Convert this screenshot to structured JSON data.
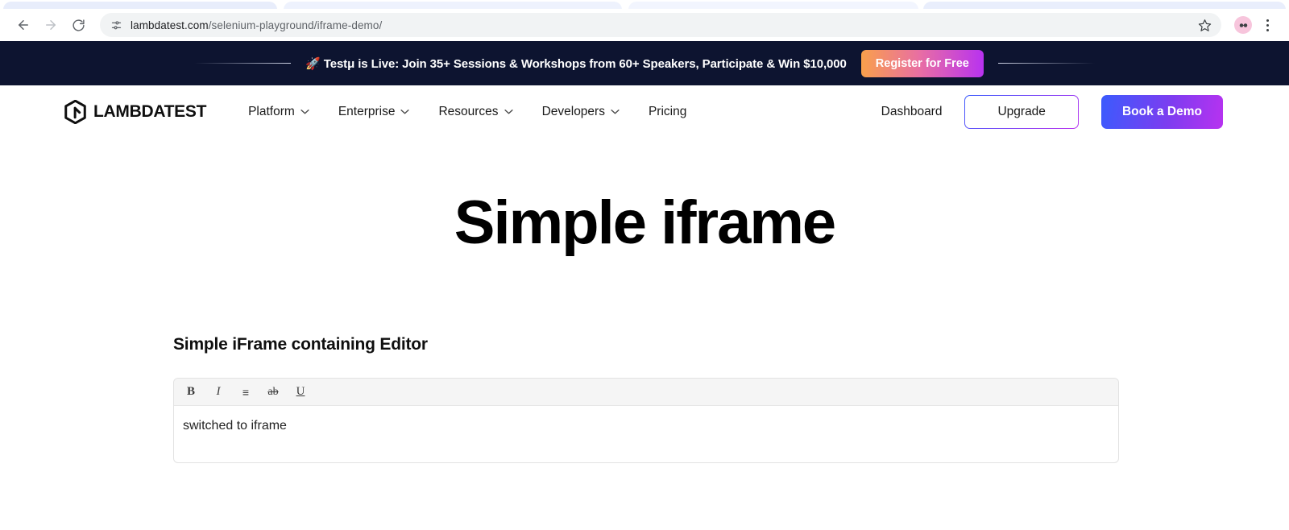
{
  "browser": {
    "back_label": "Back",
    "forward_label": "Forward",
    "reload_label": "Reload",
    "site_info_label": "Site information",
    "url_prefix": "lambdatest.com",
    "url_path": "/selenium-playground/iframe-demo/",
    "bookmark_label": "Bookmark this tab",
    "profile_label": "Profile",
    "menu_label": "Customize and control Chrome"
  },
  "promo": {
    "rocket": "🚀",
    "message": "Testμ is Live: Join 35+ Sessions & Workshops from 60+ Speakers, Participate & Win $10,000",
    "cta_label": "Register for Free",
    "background": "#0d1430",
    "cta_gradient_start": "#f9a04b",
    "cta_gradient_end": "#b832f0"
  },
  "nav": {
    "brand": "LAMBDATEST",
    "links": [
      {
        "label": "Platform",
        "has_chevron": true
      },
      {
        "label": "Enterprise",
        "has_chevron": true
      },
      {
        "label": "Resources",
        "has_chevron": true
      },
      {
        "label": "Developers",
        "has_chevron": true
      },
      {
        "label": "Pricing",
        "has_chevron": false
      }
    ],
    "dashboard_label": "Dashboard",
    "upgrade_label": "Upgrade",
    "demo_label": "Book a Demo",
    "demo_gradient_start": "#3b5bfd",
    "demo_gradient_end": "#b832f0"
  },
  "main": {
    "page_title": "Simple iframe",
    "section_title": "Simple iFrame containing Editor",
    "editor": {
      "tools": [
        {
          "name": "bold-tool",
          "glyph": "B"
        },
        {
          "name": "italic-tool",
          "glyph": "I"
        },
        {
          "name": "list-tool",
          "glyph": "≡"
        },
        {
          "name": "strikethrough-tool",
          "glyph": "ab"
        },
        {
          "name": "underline-tool",
          "glyph": "U"
        }
      ],
      "content": "switched to iframe"
    }
  }
}
